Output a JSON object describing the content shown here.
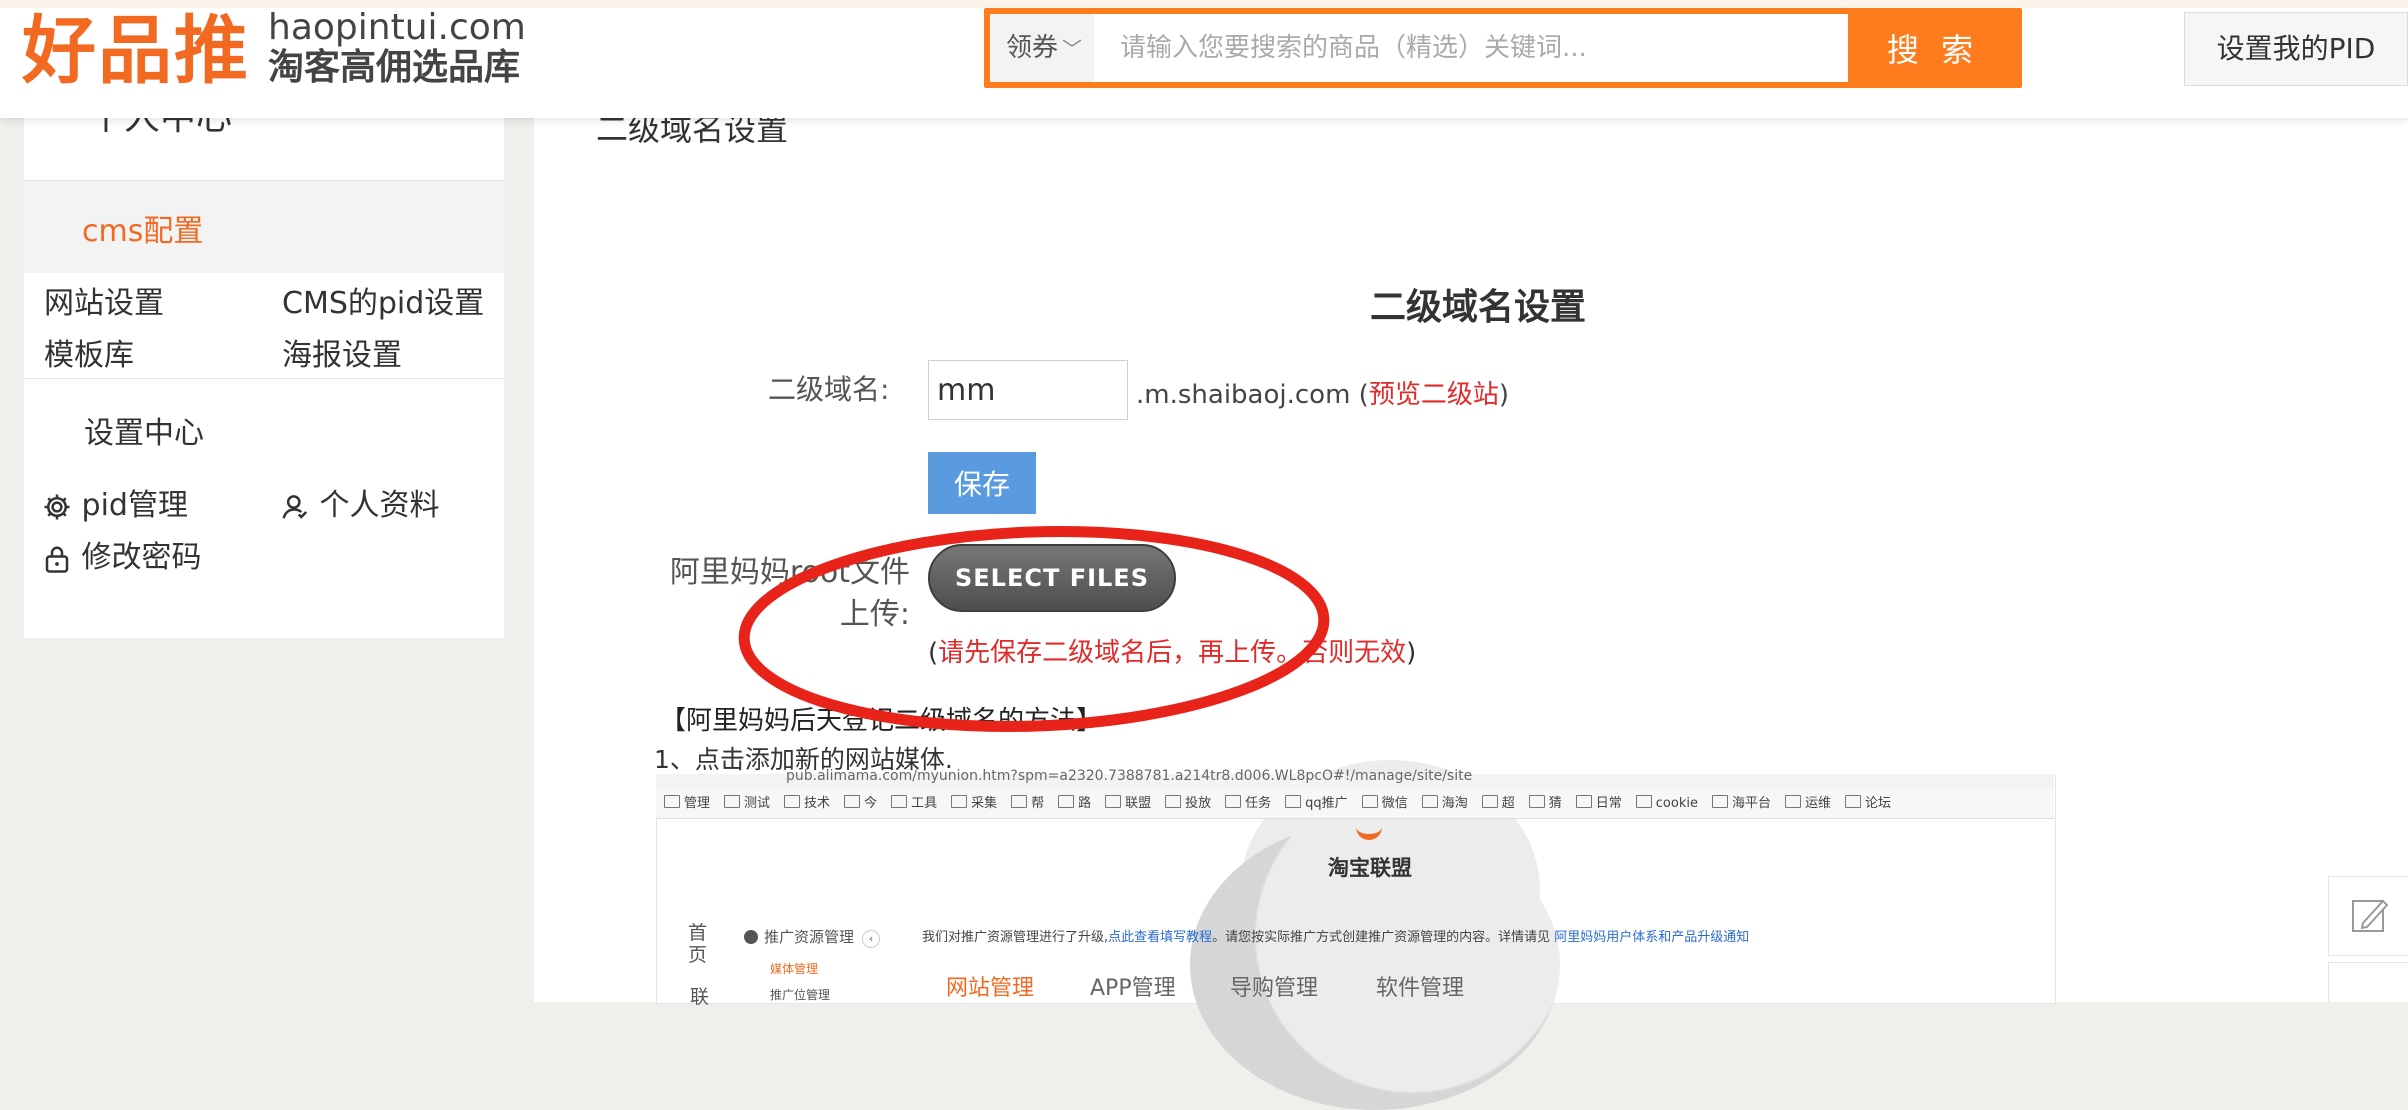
{
  "header": {
    "logo_cn": "好品推",
    "logo_en": "haopintui.com",
    "logo_sub": "淘客高佣选品库",
    "search_category": "领券",
    "search_placeholder": "请输入您要搜索的商品（精选）关键词...",
    "search_button": "搜 索",
    "pid_button": "设置我的PID"
  },
  "sidebar": {
    "title": "个人中心",
    "cms_section": "cms配置",
    "links_row1": [
      "网站设置",
      "CMS的pid设置"
    ],
    "links_row2": [
      "模板库",
      "海报设置"
    ],
    "setting_section": "设置中心",
    "pid_manage": "pid管理",
    "profile": "个人资料",
    "change_password": "修改密码"
  },
  "main": {
    "breadcrumb": "二级域名设置",
    "heading": "二级域名设置",
    "domain_label": "二级域名:",
    "domain_value": "mm",
    "domain_suffix": ".m.shaibaoj.com (",
    "preview_link": "预览二级站",
    "domain_suffix_close": ")",
    "save_button": "保存",
    "upload_label": "阿里妈妈root文件上传:",
    "select_files": "SELECT FILES",
    "warning_open": "(",
    "warning_text": "请先保存二级域名后，再上传。否则无效",
    "warning_close": ")",
    "howto_title": "【阿里妈妈后天登记二级域名的方法】",
    "howto_step1": "1、点击添加新的网站媒体."
  },
  "embedded": {
    "url": "pub.alimama.com/myunion.htm?spm=a2320.7388781.a214tr8.d006.WL8pcO#!/manage/site/site",
    "bookmarks": [
      "管理",
      "测试",
      "技术",
      "今",
      "工具",
      "采集",
      "帮",
      "路",
      "联盟",
      "投放",
      "任务",
      "qq推广",
      "微信",
      "海淘",
      "超",
      "猜",
      "日常",
      "cookie",
      "海平台",
      "运维",
      "论坛"
    ],
    "brand": "淘宝联盟",
    "nav_home": "首\n页",
    "nav_union": "联",
    "side_title": "推广资源管理",
    "side_item_a": "媒体管理",
    "side_item_b": "推广位管理",
    "notice": "我们对推广资源管理进行了升级,",
    "notice_link1": "点此查看填写教程",
    "notice_mid": "。请您按实际推广方式创建推广资源管理的内容。详情请见 ",
    "notice_link2": "阿里妈妈用户体系和产品升级通知",
    "tab_web": "网站管理",
    "tab_app": "APP管理",
    "tab_guide": "导购管理",
    "tab_soft": "软件管理"
  },
  "colors": {
    "brand_orange": "#f26a21",
    "search_orange": "#ff7c1e",
    "save_blue": "#5a9be0",
    "warning_red": "#e02b2b",
    "annotation_red": "#e8231a"
  }
}
